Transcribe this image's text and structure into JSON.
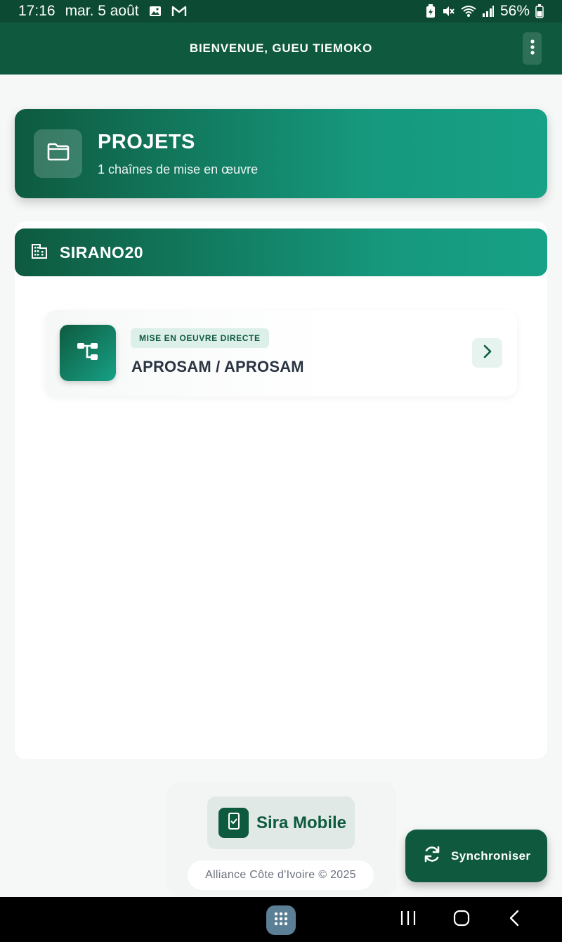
{
  "status_bar": {
    "time": "17:16",
    "date": "mar. 5 août",
    "battery": "56%"
  },
  "app_bar": {
    "title": "BIENVENUE, GUEU TIEMOKO",
    "menu_icon": "more-vertical-icon"
  },
  "projects": {
    "title": "PROJETS",
    "subtitle": "1 chaînes de mise en œuvre",
    "icon": "folder-icon"
  },
  "organization": {
    "name": "SIRANO20",
    "icon": "building-icon",
    "chains": [
      {
        "badge": "MISE EN OEUVRE DIRECTE",
        "name": "APROSAM / APROSAM",
        "icon": "hierarchy-icon"
      }
    ]
  },
  "footer": {
    "brand": "Sira Mobile",
    "copyright": "Alliance Côte d'Ivoire © 2025"
  },
  "sync_button": {
    "label": "Synchroniser",
    "icon": "sync-icon"
  },
  "colors": {
    "primary": "#0f5a3e",
    "accent": "#17a186",
    "badge_bg": "#dcefe8"
  }
}
